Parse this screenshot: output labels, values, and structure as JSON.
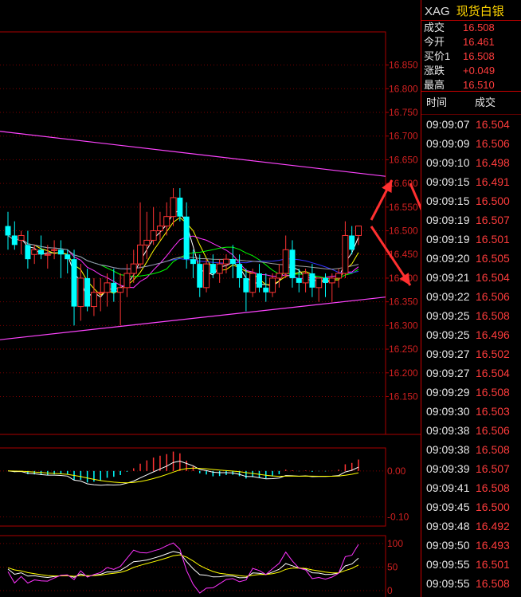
{
  "header": {
    "symbol": "XAG",
    "name": "现货白银"
  },
  "quote": [
    {
      "label": "成交",
      "value": "16.508"
    },
    {
      "label": "今开",
      "value": "16.461"
    },
    {
      "label": "买价1",
      "value": "16.508"
    },
    {
      "label": "涨跌",
      "value": "+0.049"
    },
    {
      "label": "最高",
      "value": "16.510"
    }
  ],
  "ticks_table": {
    "headers": [
      "时间",
      "成交"
    ],
    "rows": [
      {
        "time": "09:09:07",
        "price": "16.504"
      },
      {
        "time": "09:09:09",
        "price": "16.506"
      },
      {
        "time": "09:09:10",
        "price": "16.498"
      },
      {
        "time": "09:09:15",
        "price": "16.491"
      },
      {
        "time": "09:09:15",
        "price": "16.500"
      },
      {
        "time": "09:09:19",
        "price": "16.507"
      },
      {
        "time": "09:09:19",
        "price": "16.501"
      },
      {
        "time": "09:09:20",
        "price": "16.505"
      },
      {
        "time": "09:09:21",
        "price": "16.504"
      },
      {
        "time": "09:09:22",
        "price": "16.506"
      },
      {
        "time": "09:09:25",
        "price": "16.508"
      },
      {
        "time": "09:09:25",
        "price": "16.496"
      },
      {
        "time": "09:09:27",
        "price": "16.502"
      },
      {
        "time": "09:09:27",
        "price": "16.504"
      },
      {
        "time": "09:09:29",
        "price": "16.508"
      },
      {
        "time": "09:09:30",
        "price": "16.503"
      },
      {
        "time": "09:09:38",
        "price": "16.506"
      },
      {
        "time": "09:09:38",
        "price": "16.508"
      },
      {
        "time": "09:09:39",
        "price": "16.507"
      },
      {
        "time": "09:09:41",
        "price": "16.508"
      },
      {
        "time": "09:09:45",
        "price": "16.500"
      },
      {
        "time": "09:09:48",
        "price": "16.492"
      },
      {
        "time": "09:09:50",
        "price": "16.493"
      },
      {
        "time": "09:09:55",
        "price": "16.501"
      },
      {
        "time": "09:09:55",
        "price": "16.508"
      }
    ]
  },
  "chart_data": [
    {
      "type": "candlestick",
      "y_ticks": [
        "16.850",
        "16.800",
        "16.750",
        "16.700",
        "16.650",
        "16.600",
        "16.550",
        "16.500",
        "16.450",
        "16.400",
        "16.350",
        "16.300",
        "16.250",
        "16.200",
        "16.150"
      ],
      "ylim": [
        16.07,
        16.92
      ],
      "colors": {
        "up": "#ff3333",
        "down": "#00ffff",
        "ma1": "#ffffff",
        "ma2": "#ffff00",
        "ma3": "#ff33ff",
        "ma4": "#00ff00",
        "ma5": "#3333ff",
        "ma6": "#a0a0a0",
        "trend": "#ff44ff",
        "arrow": "#ff3030"
      },
      "candles": [
        {
          "o": 16.51,
          "h": 16.54,
          "l": 16.46,
          "c": 16.49
        },
        {
          "o": 16.49,
          "h": 16.52,
          "l": 16.46,
          "c": 16.47
        },
        {
          "o": 16.48,
          "h": 16.5,
          "l": 16.45,
          "c": 16.49
        },
        {
          "o": 16.47,
          "h": 16.5,
          "l": 16.42,
          "c": 16.44
        },
        {
          "o": 16.45,
          "h": 16.47,
          "l": 16.43,
          "c": 16.46
        },
        {
          "o": 16.46,
          "h": 16.49,
          "l": 16.44,
          "c": 16.45
        },
        {
          "o": 16.45,
          "h": 16.47,
          "l": 16.42,
          "c": 16.45
        },
        {
          "o": 16.46,
          "h": 16.48,
          "l": 16.44,
          "c": 16.46
        },
        {
          "o": 16.46,
          "h": 16.48,
          "l": 16.4,
          "c": 16.45
        },
        {
          "o": 16.45,
          "h": 16.46,
          "l": 16.41,
          "c": 16.44
        },
        {
          "o": 16.44,
          "h": 16.46,
          "l": 16.3,
          "c": 16.34
        },
        {
          "o": 16.34,
          "h": 16.43,
          "l": 16.31,
          "c": 16.4
        },
        {
          "o": 16.4,
          "h": 16.42,
          "l": 16.33,
          "c": 16.34
        },
        {
          "o": 16.34,
          "h": 16.4,
          "l": 16.32,
          "c": 16.37
        },
        {
          "o": 16.37,
          "h": 16.4,
          "l": 16.33,
          "c": 16.37
        },
        {
          "o": 16.37,
          "h": 16.41,
          "l": 16.34,
          "c": 16.39
        },
        {
          "o": 16.39,
          "h": 16.42,
          "l": 16.35,
          "c": 16.37
        },
        {
          "o": 16.37,
          "h": 16.41,
          "l": 16.3,
          "c": 16.38
        },
        {
          "o": 16.38,
          "h": 16.43,
          "l": 16.36,
          "c": 16.41
        },
        {
          "o": 16.41,
          "h": 16.46,
          "l": 16.39,
          "c": 16.43
        },
        {
          "o": 16.43,
          "h": 16.56,
          "l": 16.42,
          "c": 16.47
        },
        {
          "o": 16.47,
          "h": 16.54,
          "l": 16.44,
          "c": 16.48
        },
        {
          "o": 16.48,
          "h": 16.55,
          "l": 16.47,
          "c": 16.5
        },
        {
          "o": 16.5,
          "h": 16.54,
          "l": 16.48,
          "c": 16.51
        },
        {
          "o": 16.51,
          "h": 16.56,
          "l": 16.49,
          "c": 16.53
        },
        {
          "o": 16.53,
          "h": 16.59,
          "l": 16.51,
          "c": 16.57
        },
        {
          "o": 16.57,
          "h": 16.59,
          "l": 16.52,
          "c": 16.53
        },
        {
          "o": 16.53,
          "h": 16.56,
          "l": 16.42,
          "c": 16.44
        },
        {
          "o": 16.44,
          "h": 16.46,
          "l": 16.4,
          "c": 16.43
        },
        {
          "o": 16.43,
          "h": 16.45,
          "l": 16.36,
          "c": 16.38
        },
        {
          "o": 16.38,
          "h": 16.44,
          "l": 16.37,
          "c": 16.43
        },
        {
          "o": 16.43,
          "h": 16.45,
          "l": 16.4,
          "c": 16.41
        },
        {
          "o": 16.41,
          "h": 16.44,
          "l": 16.39,
          "c": 16.43
        },
        {
          "o": 16.43,
          "h": 16.45,
          "l": 16.41,
          "c": 16.44
        },
        {
          "o": 16.44,
          "h": 16.47,
          "l": 16.4,
          "c": 16.43
        },
        {
          "o": 16.43,
          "h": 16.45,
          "l": 16.38,
          "c": 16.4
        },
        {
          "o": 16.4,
          "h": 16.42,
          "l": 16.33,
          "c": 16.37
        },
        {
          "o": 16.37,
          "h": 16.42,
          "l": 16.36,
          "c": 16.41
        },
        {
          "o": 16.41,
          "h": 16.43,
          "l": 16.37,
          "c": 16.38
        },
        {
          "o": 16.38,
          "h": 16.41,
          "l": 16.35,
          "c": 16.37
        },
        {
          "o": 16.37,
          "h": 16.41,
          "l": 16.36,
          "c": 16.4
        },
        {
          "o": 16.4,
          "h": 16.43,
          "l": 16.38,
          "c": 16.41
        },
        {
          "o": 16.41,
          "h": 16.49,
          "l": 16.4,
          "c": 16.46
        },
        {
          "o": 16.46,
          "h": 16.48,
          "l": 16.38,
          "c": 16.4
        },
        {
          "o": 16.4,
          "h": 16.42,
          "l": 16.37,
          "c": 16.39
        },
        {
          "o": 16.39,
          "h": 16.42,
          "l": 16.37,
          "c": 16.41
        },
        {
          "o": 16.41,
          "h": 16.43,
          "l": 16.36,
          "c": 16.38
        },
        {
          "o": 16.38,
          "h": 16.4,
          "l": 16.35,
          "c": 16.4
        },
        {
          "o": 16.4,
          "h": 16.41,
          "l": 16.36,
          "c": 16.39
        },
        {
          "o": 16.39,
          "h": 16.41,
          "l": 16.35,
          "c": 16.4
        },
        {
          "o": 16.4,
          "h": 16.42,
          "l": 16.38,
          "c": 16.41
        },
        {
          "o": 16.41,
          "h": 16.52,
          "l": 16.4,
          "c": 16.49
        },
        {
          "o": 16.49,
          "h": 16.51,
          "l": 16.45,
          "c": 16.46
        },
        {
          "o": 16.49,
          "h": 16.51,
          "l": 16.47,
          "c": 16.51
        }
      ]
    },
    {
      "type": "macd",
      "y_ticks": [
        "0.00",
        "-0.10"
      ],
      "ylim": [
        -0.12,
        0.05
      ]
    },
    {
      "type": "kdj",
      "y_ticks": [
        "100",
        "50",
        "0"
      ],
      "ylim": [
        0,
        110
      ]
    }
  ]
}
